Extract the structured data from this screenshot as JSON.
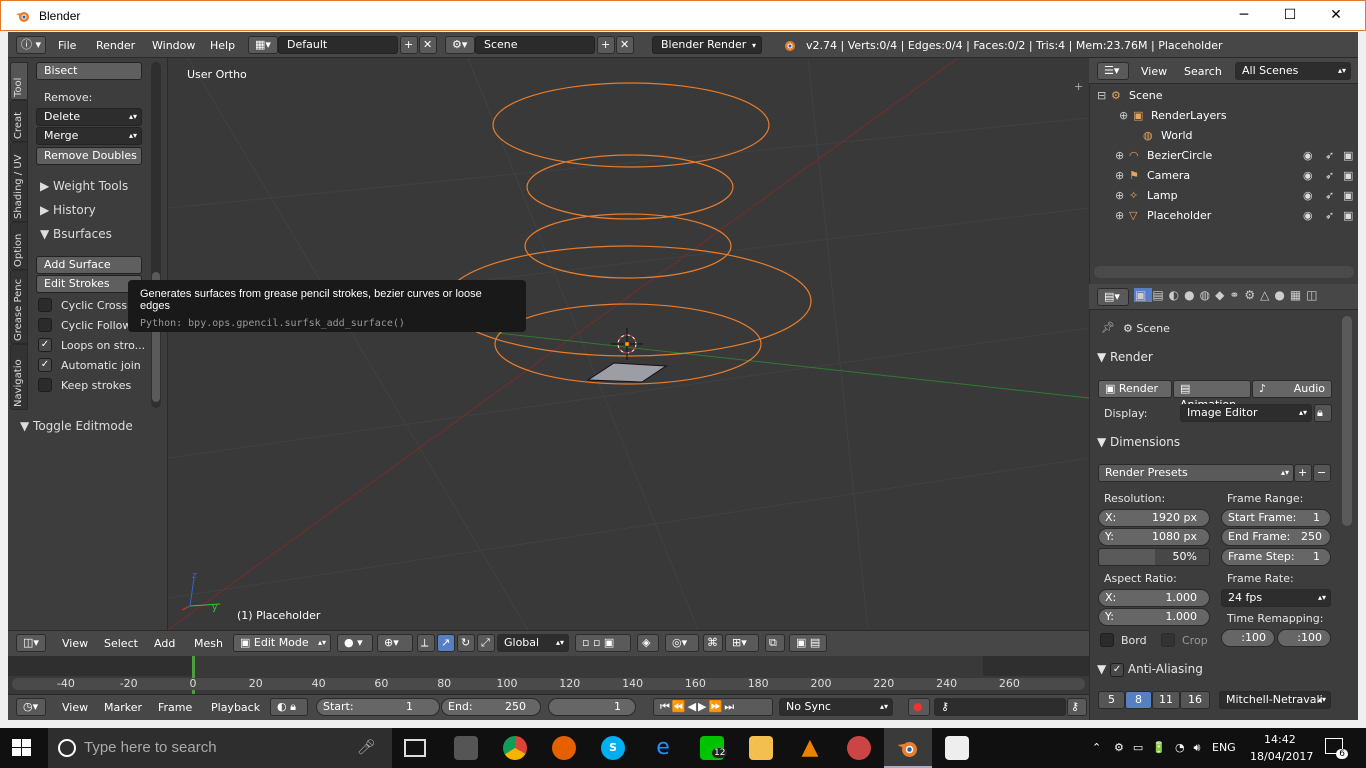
{
  "window": {
    "title": "Blender",
    "minimize": "─",
    "maximize": "☐",
    "close": "✕"
  },
  "infobar": {
    "menus": [
      "File",
      "Render",
      "Window",
      "Help"
    ],
    "layout": "Default",
    "scene": "Scene",
    "engine": "Blender Render",
    "stats": "v2.74 | Verts:0/4 | Edges:0/4 | Faces:0/2 | Tris:4 | Mem:23.76M | Placeholder"
  },
  "toolshelf": {
    "tabs": [
      "Tool",
      "Creat",
      "Shading / UV",
      "Option",
      "Grease Penc",
      "Navigatio"
    ],
    "bisect": "Bisect",
    "remove_label": "Remove:",
    "delete": "Delete",
    "merge": "Merge",
    "remove_doubles": "Remove Doubles",
    "weight_tools": "Weight Tools",
    "history": "History",
    "bsurfaces": "Bsurfaces",
    "add_surface": "Add Surface",
    "edit_strokes": "Edit Strokes",
    "checks": [
      {
        "label": "Cyclic Cross",
        "checked": false
      },
      {
        "label": "Cyclic Follow",
        "checked": false
      },
      {
        "label": "Loops on stro...",
        "checked": true
      },
      {
        "label": "Automatic join",
        "checked": true
      },
      {
        "label": "Keep strokes",
        "checked": false
      }
    ],
    "toggle_editmode": "Toggle Editmode"
  },
  "tooltip": {
    "text": "Generates surfaces from grease pencil strokes, bezier curves or loose edges",
    "python": "Python: bpy.ops.gpencil.surfsk_add_surface()"
  },
  "viewport": {
    "view_name": "User Ortho",
    "object_label": "(1) Placeholder"
  },
  "vpheader": {
    "menus": [
      "View",
      "Select",
      "Add",
      "Mesh"
    ],
    "mode": "Edit Mode",
    "orientation": "Global"
  },
  "timeline": {
    "ticks": [
      "-40",
      "-20",
      "0",
      "20",
      "40",
      "60",
      "80",
      "100",
      "120",
      "140",
      "160",
      "180",
      "200",
      "220",
      "240",
      "260"
    ],
    "menus": [
      "View",
      "Marker",
      "Frame",
      "Playback"
    ],
    "start_label": "Start:",
    "start": "1",
    "end_label": "End:",
    "end": "250",
    "current": "1",
    "sync": "No Sync"
  },
  "outliner": {
    "menus": [
      "View",
      "Search"
    ],
    "filter": "All Scenes",
    "items": [
      {
        "name": "Scene",
        "icon": "scene-icon"
      },
      {
        "name": "RenderLayers",
        "icon": "renderlayers-icon"
      },
      {
        "name": "World",
        "icon": "world-icon"
      },
      {
        "name": "BezierCircle",
        "icon": "curve-icon"
      },
      {
        "name": "Camera",
        "icon": "camera-icon"
      },
      {
        "name": "Lamp",
        "icon": "lamp-icon"
      },
      {
        "name": "Placeholder",
        "icon": "mesh-icon"
      }
    ]
  },
  "properties": {
    "context": "Scene",
    "render_panel": "Render",
    "render_btn": "Render",
    "animation_btn": "Animation",
    "audio_btn": "Audio",
    "display_label": "Display:",
    "display": "Image Editor",
    "dimensions_panel": "Dimensions",
    "presets": "Render Presets",
    "resolution_label": "Resolution:",
    "res_x_label": "X:",
    "res_x": "1920 px",
    "res_y_label": "Y:",
    "res_y": "1080 px",
    "res_pct": "50%",
    "frame_range_label": "Frame Range:",
    "start_frame_label": "Start Frame:",
    "start_frame": "1",
    "end_frame_label": "End Frame:",
    "end_frame": "250",
    "frame_step_label": "Frame Step:",
    "frame_step": "1",
    "aspect_label": "Aspect Ratio:",
    "asp_x_label": "X:",
    "asp_x": "1.000",
    "asp_y_label": "Y:",
    "asp_y": "1.000",
    "frame_rate_label": "Frame Rate:",
    "frame_rate": "24 fps",
    "remap_label": "Time Remapping:",
    "remap_old": ":100",
    "remap_new": ":100",
    "bord": "Bord",
    "crop": "Crop",
    "aa_panel": "Anti-Aliasing",
    "aa_samples": [
      "5",
      "8",
      "11",
      "16"
    ],
    "aa_filter": "Mitchell-Netravali"
  },
  "taskbar": {
    "search": "Type here to search",
    "lang": "ENG",
    "time": "14:42",
    "date": "18/04/2017",
    "notif_count": "6",
    "line_badge": "12"
  },
  "colors": {
    "orange": "#e87d2d",
    "accent_blue": "#5680c2",
    "frame_bg": "#3d3d3d"
  }
}
